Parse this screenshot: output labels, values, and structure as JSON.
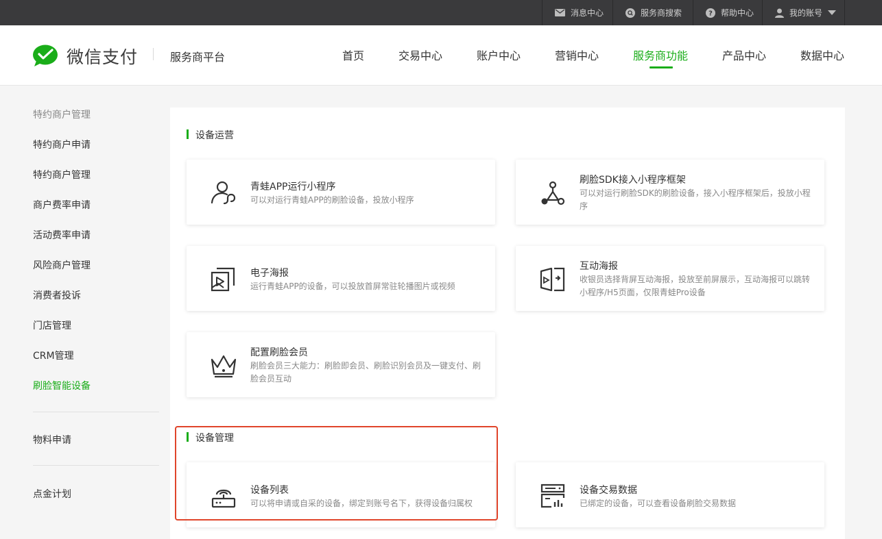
{
  "topbar": {
    "messages": "消息中心",
    "provider_search": "服务商搜索",
    "help": "帮助中心",
    "account": "我的账号"
  },
  "header": {
    "logo_text": "微信支付",
    "platform": "服务商平台",
    "nav": [
      "首页",
      "交易中心",
      "账户中心",
      "营销中心",
      "服务商功能",
      "产品中心",
      "数据中心"
    ],
    "active_nav": "服务商功能"
  },
  "sidebar": {
    "group_title": "特约商户管理",
    "items": [
      "特约商户申请",
      "特约商户管理",
      "商户费率申请",
      "活动费率申请",
      "风险商户管理",
      "消费者投诉",
      "门店管理",
      "CRM管理",
      "刷脸智能设备"
    ],
    "active_item": "刷脸智能设备",
    "material": "物料申请",
    "gold_plan": "点金计划"
  },
  "sections": {
    "operation": {
      "title": "设备运营",
      "cards": [
        {
          "title": "青蛙APP运行小程序",
          "desc": "可以对运行青蛙APP的刷脸设备，投放小程序",
          "icon": "user-link-icon"
        },
        {
          "title": "刷脸SDK接入小程序框架",
          "desc": "可以对运行刷脸SDK的刷脸设备，接入小程序框架后，投放小程序",
          "icon": "network-nodes-icon"
        },
        {
          "title": "电子海报",
          "desc": "运行青蛙APP的设备，可以投放首屏常驻轮播图片或视频",
          "icon": "video-poster-icon"
        },
        {
          "title": "互动海报",
          "desc": "收银员选择背屏互动海报，投放至前屏展示，互动海报可以跳转小程序/H5页面，仅限青蛙Pro设备",
          "icon": "interactive-poster-icon"
        },
        {
          "title": "配置刷脸会员",
          "desc": "刷脸会员三大能力：刷脸即会员、刷脸识别会员及一键支付、刷脸会员互动",
          "icon": "crown-icon"
        }
      ]
    },
    "management": {
      "title": "设备管理",
      "cards": [
        {
          "title": "设备列表",
          "desc": "可以将申请或自采的设备，绑定到账号名下，获得设备归属权",
          "icon": "device-router-icon"
        },
        {
          "title": "设备交易数据",
          "desc": "已绑定的设备，可以查看设备刷脸交易数据",
          "icon": "device-data-icon"
        }
      ]
    }
  },
  "colors": {
    "accent": "#1aad19",
    "highlight_border": "#e0442a",
    "topbar_bg": "#3a3a3c"
  }
}
